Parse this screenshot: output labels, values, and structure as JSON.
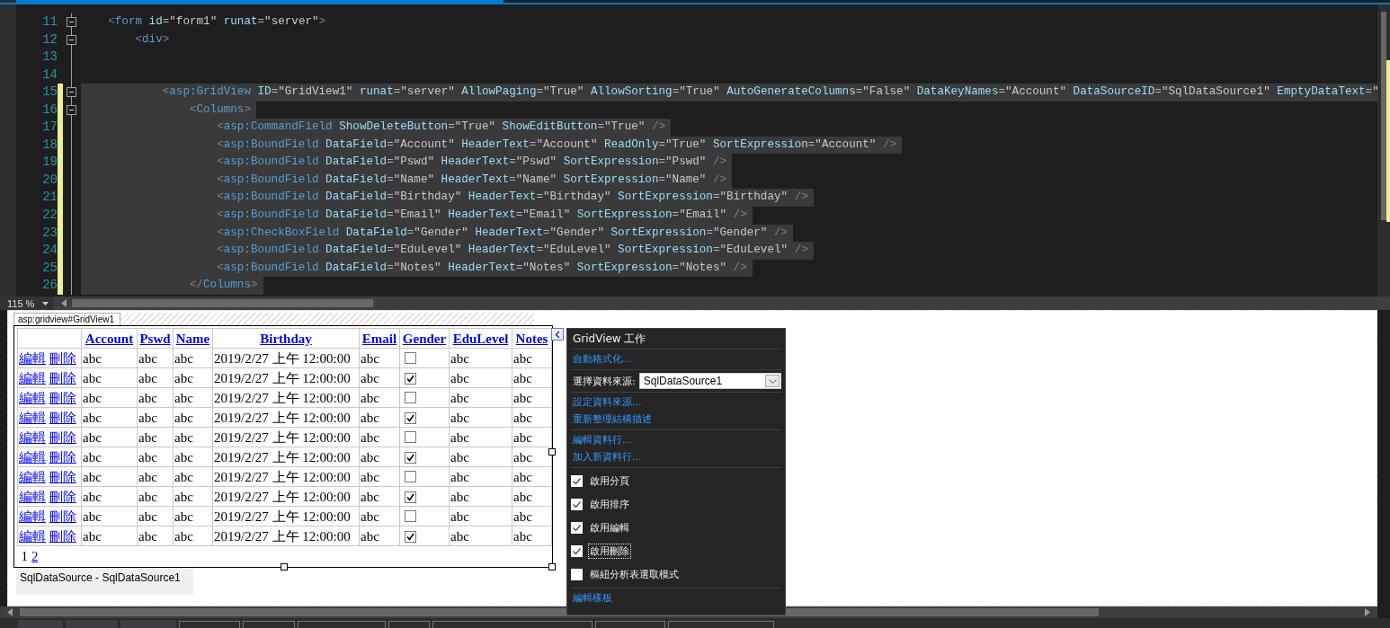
{
  "editor": {
    "lines": [
      {
        "number": "11",
        "text": "    <form id=\"form1\" runat=\"server\">",
        "foldable": true,
        "modified": false,
        "selected": false
      },
      {
        "number": "12",
        "text": "        <div>",
        "foldable": true,
        "modified": false,
        "selected": false
      },
      {
        "number": "13",
        "foldable": false,
        "modified": false,
        "selected": false
      },
      {
        "number": "14",
        "foldable": false,
        "modified": false,
        "selected": false
      },
      {
        "number": "15",
        "text": "            <asp:GridView ID=\"GridView1\" runat=\"server\" AllowPaging=\"True\" AllowSorting=\"True\" AutoGenerateColumns=\"False\" DataKeyNames=\"Account\" DataSourceID=\"SqlDataSource1\" EmptyDataText=\"",
        "foldable": true,
        "modified": true,
        "selected": true
      },
      {
        "number": "16",
        "text": "                <Columns>",
        "foldable": true,
        "modified": true,
        "selected": true
      },
      {
        "number": "17",
        "text": "                    <asp:CommandField ShowDeleteButton=\"True\" ShowEditButton=\"True\" />",
        "foldable": false,
        "modified": true,
        "selected": true
      },
      {
        "number": "18",
        "text": "                    <asp:BoundField DataField=\"Account\" HeaderText=\"Account\" ReadOnly=\"True\" SortExpression=\"Account\" />",
        "foldable": false,
        "modified": true,
        "selected": true
      },
      {
        "number": "19",
        "text": "                    <asp:BoundField DataField=\"Pswd\" HeaderText=\"Pswd\" SortExpression=\"Pswd\" />",
        "foldable": false,
        "modified": true,
        "selected": true
      },
      {
        "number": "20",
        "text": "                    <asp:BoundField DataField=\"Name\" HeaderText=\"Name\" SortExpression=\"Name\" />",
        "foldable": false,
        "modified": true,
        "selected": true
      },
      {
        "number": "21",
        "text": "                    <asp:BoundField DataField=\"Birthday\" HeaderText=\"Birthday\" SortExpression=\"Birthday\" />",
        "foldable": false,
        "modified": true,
        "selected": true
      },
      {
        "number": "22",
        "text": "                    <asp:BoundField DataField=\"Email\" HeaderText=\"Email\" SortExpression=\"Email\" />",
        "foldable": false,
        "modified": true,
        "selected": true
      },
      {
        "number": "23",
        "text": "                    <asp:CheckBoxField DataField=\"Gender\" HeaderText=\"Gender\" SortExpression=\"Gender\" />",
        "foldable": false,
        "modified": true,
        "selected": true
      },
      {
        "number": "24",
        "text": "                    <asp:BoundField DataField=\"EduLevel\" HeaderText=\"EduLevel\" SortExpression=\"EduLevel\" />",
        "foldable": false,
        "modified": true,
        "selected": true
      },
      {
        "number": "25",
        "text": "                    <asp:BoundField DataField=\"Notes\" HeaderText=\"Notes\" SortExpression=\"Notes\" />",
        "foldable": false,
        "modified": true,
        "selected": true
      },
      {
        "number": "26",
        "text": "                </Columns>",
        "foldable": false,
        "modified": true,
        "selected": true
      }
    ],
    "zoom": "115 %"
  },
  "designer": {
    "control_tag": "asp:gridview#GridView1",
    "table": {
      "columns": [
        {
          "label": "Account"
        },
        {
          "label": "Pswd"
        },
        {
          "label": "Name"
        },
        {
          "label": "Birthday"
        },
        {
          "label": "Email"
        },
        {
          "label": "Gender"
        },
        {
          "label": "EduLevel"
        },
        {
          "label": "Notes"
        }
      ],
      "rows": [
        {
          "links": [
            "編輯",
            "刪除"
          ],
          "cells": [
            {
              "kind": "text",
              "text": "abc"
            },
            {
              "kind": "text",
              "text": "abc"
            },
            {
              "kind": "text",
              "text": "abc"
            },
            {
              "kind": "text",
              "text": "2019/2/27 上午 12:00:00"
            },
            {
              "kind": "text",
              "text": "abc"
            },
            {
              "kind": "checkbox",
              "checked": false
            },
            {
              "kind": "text",
              "text": "abc"
            },
            {
              "kind": "text",
              "text": "abc"
            }
          ]
        },
        {
          "links": [
            "編輯",
            "刪除"
          ],
          "cells": [
            {
              "kind": "text",
              "text": "abc"
            },
            {
              "kind": "text",
              "text": "abc"
            },
            {
              "kind": "text",
              "text": "abc"
            },
            {
              "kind": "text",
              "text": "2019/2/27 上午 12:00:00"
            },
            {
              "kind": "text",
              "text": "abc"
            },
            {
              "kind": "checkbox",
              "checked": true
            },
            {
              "kind": "text",
              "text": "abc"
            },
            {
              "kind": "text",
              "text": "abc"
            }
          ]
        },
        {
          "links": [
            "編輯",
            "刪除"
          ],
          "cells": [
            {
              "kind": "text",
              "text": "abc"
            },
            {
              "kind": "text",
              "text": "abc"
            },
            {
              "kind": "text",
              "text": "abc"
            },
            {
              "kind": "text",
              "text": "2019/2/27 上午 12:00:00"
            },
            {
              "kind": "text",
              "text": "abc"
            },
            {
              "kind": "checkbox",
              "checked": false
            },
            {
              "kind": "text",
              "text": "abc"
            },
            {
              "kind": "text",
              "text": "abc"
            }
          ]
        },
        {
          "links": [
            "編輯",
            "刪除"
          ],
          "cells": [
            {
              "kind": "text",
              "text": "abc"
            },
            {
              "kind": "text",
              "text": "abc"
            },
            {
              "kind": "text",
              "text": "abc"
            },
            {
              "kind": "text",
              "text": "2019/2/27 上午 12:00:00"
            },
            {
              "kind": "text",
              "text": "abc"
            },
            {
              "kind": "checkbox",
              "checked": true
            },
            {
              "kind": "text",
              "text": "abc"
            },
            {
              "kind": "text",
              "text": "abc"
            }
          ]
        },
        {
          "links": [
            "編輯",
            "刪除"
          ],
          "cells": [
            {
              "kind": "text",
              "text": "abc"
            },
            {
              "kind": "text",
              "text": "abc"
            },
            {
              "kind": "text",
              "text": "abc"
            },
            {
              "kind": "text",
              "text": "2019/2/27 上午 12:00:00"
            },
            {
              "kind": "text",
              "text": "abc"
            },
            {
              "kind": "checkbox",
              "checked": false
            },
            {
              "kind": "text",
              "text": "abc"
            },
            {
              "kind": "text",
              "text": "abc"
            }
          ]
        },
        {
          "links": [
            "編輯",
            "刪除"
          ],
          "cells": [
            {
              "kind": "text",
              "text": "abc"
            },
            {
              "kind": "text",
              "text": "abc"
            },
            {
              "kind": "text",
              "text": "abc"
            },
            {
              "kind": "text",
              "text": "2019/2/27 上午 12:00:00"
            },
            {
              "kind": "text",
              "text": "abc"
            },
            {
              "kind": "checkbox",
              "checked": true
            },
            {
              "kind": "text",
              "text": "abc"
            },
            {
              "kind": "text",
              "text": "abc"
            }
          ]
        },
        {
          "links": [
            "編輯",
            "刪除"
          ],
          "cells": [
            {
              "kind": "text",
              "text": "abc"
            },
            {
              "kind": "text",
              "text": "abc"
            },
            {
              "kind": "text",
              "text": "abc"
            },
            {
              "kind": "text",
              "text": "2019/2/27 上午 12:00:00"
            },
            {
              "kind": "text",
              "text": "abc"
            },
            {
              "kind": "checkbox",
              "checked": false
            },
            {
              "kind": "text",
              "text": "abc"
            },
            {
              "kind": "text",
              "text": "abc"
            }
          ]
        },
        {
          "links": [
            "編輯",
            "刪除"
          ],
          "cells": [
            {
              "kind": "text",
              "text": "abc"
            },
            {
              "kind": "text",
              "text": "abc"
            },
            {
              "kind": "text",
              "text": "abc"
            },
            {
              "kind": "text",
              "text": "2019/2/27 上午 12:00:00"
            },
            {
              "kind": "text",
              "text": "abc"
            },
            {
              "kind": "checkbox",
              "checked": true
            },
            {
              "kind": "text",
              "text": "abc"
            },
            {
              "kind": "text",
              "text": "abc"
            }
          ]
        },
        {
          "links": [
            "編輯",
            "刪除"
          ],
          "cells": [
            {
              "kind": "text",
              "text": "abc"
            },
            {
              "kind": "text",
              "text": "abc"
            },
            {
              "kind": "text",
              "text": "abc"
            },
            {
              "kind": "text",
              "text": "2019/2/27 上午 12:00:00"
            },
            {
              "kind": "text",
              "text": "abc"
            },
            {
              "kind": "checkbox",
              "checked": false
            },
            {
              "kind": "text",
              "text": "abc"
            },
            {
              "kind": "text",
              "text": "abc"
            }
          ]
        },
        {
          "links": [
            "編輯",
            "刪除"
          ],
          "cells": [
            {
              "kind": "text",
              "text": "abc"
            },
            {
              "kind": "text",
              "text": "abc"
            },
            {
              "kind": "text",
              "text": "abc"
            },
            {
              "kind": "text",
              "text": "2019/2/27 上午 12:00:00"
            },
            {
              "kind": "text",
              "text": "abc"
            },
            {
              "kind": "checkbox",
              "checked": true
            },
            {
              "kind": "text",
              "text": "abc"
            },
            {
              "kind": "text",
              "text": "abc"
            }
          ]
        }
      ],
      "pager": [
        {
          "label": "1",
          "selected": true
        },
        {
          "label": "2",
          "selected": false
        }
      ]
    },
    "data_source": "SqlDataSource - SqlDataSource1",
    "smart_tag": {
      "title": "GridView 工作",
      "sections": [
        [
          {
            "kind": "link",
            "label": "自動格式化..."
          }
        ],
        [
          {
            "kind": "dropdown",
            "label": "選擇資料來源:",
            "value": "SqlDataSource1"
          }
        ],
        [
          {
            "kind": "link",
            "label": "設定資料來源..."
          },
          {
            "kind": "link",
            "label": "重新整理結構描述"
          }
        ],
        [
          {
            "kind": "link",
            "label": "編輯資料行..."
          },
          {
            "kind": "link",
            "label": "加入新資料行..."
          }
        ],
        [
          {
            "kind": "checkbox",
            "label": "啟用分頁",
            "checked": true,
            "focused": false
          },
          {
            "kind": "checkbox",
            "label": "啟用排序",
            "checked": true,
            "focused": false
          },
          {
            "kind": "checkbox",
            "label": "啟用編輯",
            "checked": true,
            "focused": false
          },
          {
            "kind": "checkbox",
            "label": "啟用刪除",
            "checked": true,
            "focused": true
          },
          {
            "kind": "checkbox",
            "label": "樞紐分析表選取模式",
            "checked": false,
            "focused": false
          }
        ],
        [
          {
            "kind": "link",
            "label": "編輯樣板"
          }
        ]
      ]
    }
  }
}
